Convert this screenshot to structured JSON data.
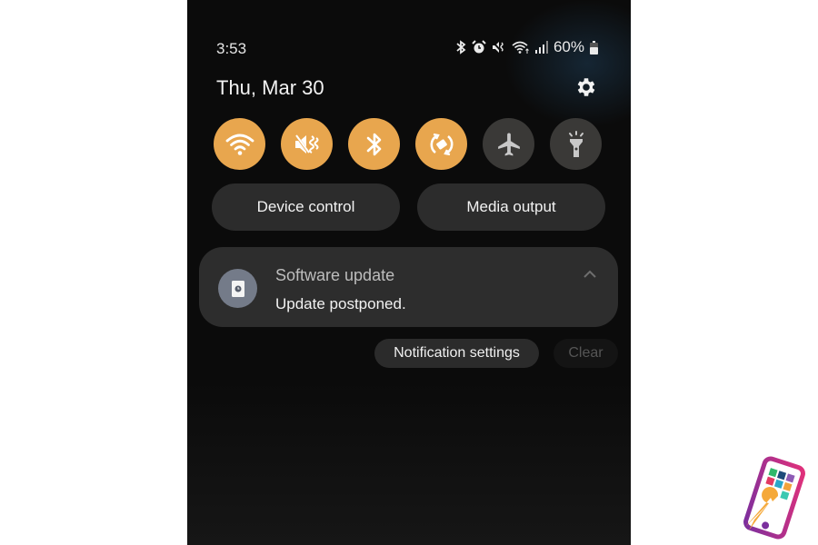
{
  "status_bar": {
    "time": "3:53",
    "icons": [
      "bluetooth-icon",
      "alarm-icon",
      "mute-icon",
      "wifi-icon",
      "signal-icon"
    ],
    "battery_percent": "60%"
  },
  "header": {
    "date": "Thu, Mar 30",
    "settings_icon": "gear-icon"
  },
  "quick_tiles": [
    {
      "name": "wifi",
      "icon": "wifi-icon",
      "state": "on"
    },
    {
      "name": "mute",
      "icon": "mute-vibrate-icon",
      "state": "on"
    },
    {
      "name": "bluetooth",
      "icon": "bluetooth-icon",
      "state": "on"
    },
    {
      "name": "auto-rotate",
      "icon": "rotate-icon",
      "state": "on"
    },
    {
      "name": "airplane-mode",
      "icon": "airplane-icon",
      "state": "off"
    },
    {
      "name": "flashlight",
      "icon": "flashlight-icon",
      "state": "off"
    }
  ],
  "colors": {
    "tile_on": "#e8a64e",
    "tile_off": "#3a3937"
  },
  "buttons": {
    "device_control": "Device control",
    "media_output": "Media output"
  },
  "notification": {
    "app": "Software update",
    "message": "Update postponed.",
    "icon": "software-update-icon"
  },
  "actions": {
    "notification_settings": "Notification settings",
    "clear": "Clear"
  }
}
